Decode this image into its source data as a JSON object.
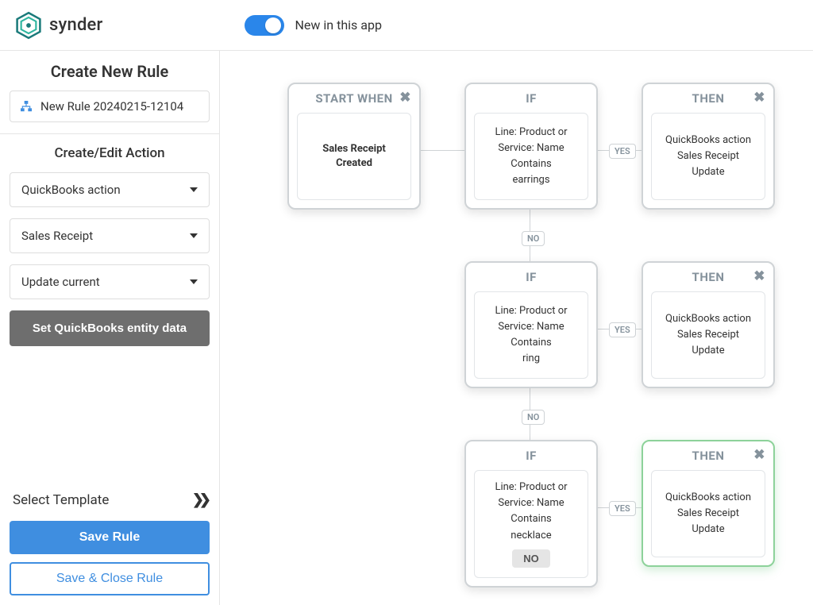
{
  "header": {
    "brand": "synder",
    "toggle_label": "New in this app"
  },
  "sidebar": {
    "title": "Create New Rule",
    "rule_name": "New Rule 20240215-12104",
    "subtitle": "Create/Edit Action",
    "dd_action_type": "QuickBooks action",
    "dd_entity": "Sales Receipt",
    "dd_mode": "Update current",
    "set_entity_btn": "Set QuickBooks entity data",
    "template_label": "Select Template",
    "save_btn": "Save Rule",
    "save_close_btn": "Save & Close Rule"
  },
  "nodes": {
    "start": {
      "head": "START WHEN",
      "body": "Sales Receipt Created"
    },
    "if1": {
      "head": "IF",
      "l1": "Line: Product or",
      "l2": "Service: Name",
      "l3": "Contains",
      "l4": "earrings"
    },
    "then1": {
      "head": "THEN",
      "l1": "QuickBooks action",
      "l2": "Sales Receipt",
      "l3": "Update"
    },
    "if2": {
      "head": "IF",
      "l1": "Line: Product or",
      "l2": "Service: Name",
      "l3": "Contains",
      "l4": "ring"
    },
    "then2": {
      "head": "THEN",
      "l1": "QuickBooks action",
      "l2": "Sales Receipt",
      "l3": "Update"
    },
    "if3": {
      "head": "IF",
      "l1": "Line: Product or",
      "l2": "Service: Name",
      "l3": "Contains",
      "l4": "necklace",
      "no_btn": "NO"
    },
    "then3": {
      "head": "THEN",
      "l1": "QuickBooks action",
      "l2": "Sales Receipt",
      "l3": "Update"
    }
  },
  "labels": {
    "yes": "YES",
    "no": "NO"
  }
}
